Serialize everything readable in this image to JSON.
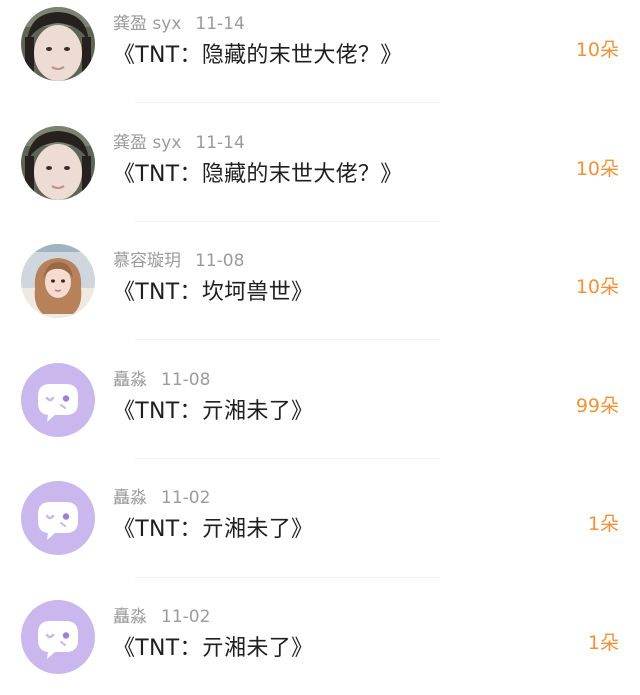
{
  "accent_color": "#f0923a",
  "items": [
    {
      "user": "龚盈 syx",
      "date": "11-14",
      "title": "《TNT：隐藏的末世大佬？》",
      "gift": "10朵",
      "avatar": "photo-girl-icon"
    },
    {
      "user": "龚盈 syx",
      "date": "11-14",
      "title": "《TNT：隐藏的末世大佬？》",
      "gift": "10朵",
      "avatar": "photo-girl-icon"
    },
    {
      "user": "慕容璇玥",
      "date": "11-08",
      "title": "《TNT：坎坷兽世》",
      "gift": "10朵",
      "avatar": "photo-woman-icon"
    },
    {
      "user": "矗淼",
      "date": "11-08",
      "title": "《TNT：亓湘未了》",
      "gift": "99朵",
      "avatar": "chat-bubble-icon"
    },
    {
      "user": "矗淼",
      "date": "11-02",
      "title": "《TNT：亓湘未了》",
      "gift": "1朵",
      "avatar": "chat-bubble-icon"
    },
    {
      "user": "矗淼",
      "date": "11-02",
      "title": "《TNT：亓湘未了》",
      "gift": "1朵",
      "avatar": "chat-bubble-icon"
    }
  ]
}
